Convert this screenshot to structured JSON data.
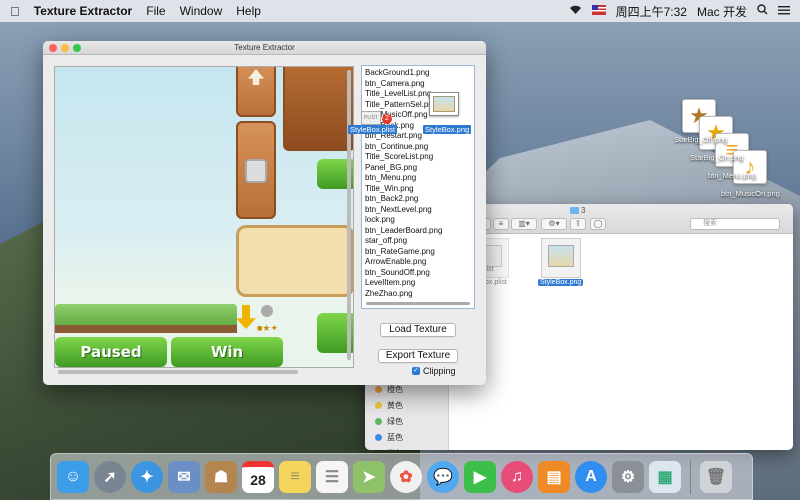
{
  "menubar": {
    "apple": "",
    "app_name": "Texture Extractor",
    "menus": [
      "File",
      "Window",
      "Help"
    ],
    "datetime": "周四上午7:32",
    "user": "Mac 开发"
  },
  "window": {
    "title": "Texture Extractor",
    "file_list": [
      "BackGround1.png",
      "btn_Camera.png",
      "Title_LevelList.png",
      "Title_PatternSel.png",
      "btn_MusicOff.png",
      "btn_Back.png",
      "btn_Restart.png",
      "btn_Continue.png",
      "Title_ScoreList.png",
      "Panel_BG.png",
      "btn_Menu.png",
      "Title_Win.png",
      "btn_Back2.png",
      "btn_NextLevel.png",
      "lock.png",
      "btn_LeaderBoard.png",
      "star_off.png",
      "btn_RateGame.png",
      "ArrowEnable.png",
      "btn_SoundOff.png",
      "LevelItem.png",
      "ZheZhao.png"
    ],
    "drag": {
      "plist_label": "StyleBox.plist",
      "png_label": "StyleBox.png",
      "badge": "2",
      "plist_ext": "PLIST"
    },
    "load_button": "Load Texture",
    "export_button": "Export Texture",
    "clipping_label": "Clipping",
    "clipping_checked": "✓",
    "texture": {
      "paused": "Paused",
      "win": "Win"
    }
  },
  "finder": {
    "title": "3",
    "search_placeholder": "搜索",
    "tags": [
      {
        "label": "橙色",
        "color": "#f39c34"
      },
      {
        "label": "黄色",
        "color": "#e9c83a"
      },
      {
        "label": "绿色",
        "color": "#5cb85c"
      },
      {
        "label": "蓝色",
        "color": "#3a8fe0"
      },
      {
        "label": "紫色",
        "color": "#a66bd1"
      }
    ],
    "files": [
      {
        "label": "StyleBox.plist",
        "partial": "list"
      },
      {
        "label": "StyleBox.png"
      }
    ]
  },
  "desktop": {
    "files": [
      "StarBig_Off.png",
      "StarBig_On.png",
      "btn_Menu.png",
      "btn_MusicOn.png"
    ]
  },
  "dock": {
    "apps": [
      {
        "name": "finder",
        "color": "#3c9ee8"
      },
      {
        "name": "launchpad",
        "color": "#7a8593"
      },
      {
        "name": "safari",
        "color": "#3b95e0"
      },
      {
        "name": "mail",
        "color": "#6a8fc4"
      },
      {
        "name": "contacts",
        "color": "#b5854f"
      },
      {
        "name": "calendar",
        "color": "#ffffff",
        "text": "28"
      },
      {
        "name": "notes",
        "color": "#f3d55b"
      },
      {
        "name": "reminders",
        "color": "#f5f5f5"
      },
      {
        "name": "maps",
        "color": "#8fc06a"
      },
      {
        "name": "photos",
        "color": "#f0f0f0"
      },
      {
        "name": "messages",
        "color": "#4fa8f0"
      },
      {
        "name": "facetime",
        "color": "#3cbf4a"
      },
      {
        "name": "itunes",
        "color": "#e84d7a"
      },
      {
        "name": "ibooks",
        "color": "#f08a24"
      },
      {
        "name": "app-store",
        "color": "#2f8ef0"
      },
      {
        "name": "system-preferences",
        "color": "#8b8f96"
      },
      {
        "name": "texture-extractor",
        "color": "#dce6ee"
      },
      {
        "name": "trash",
        "color": "#cfd3d8"
      }
    ]
  }
}
